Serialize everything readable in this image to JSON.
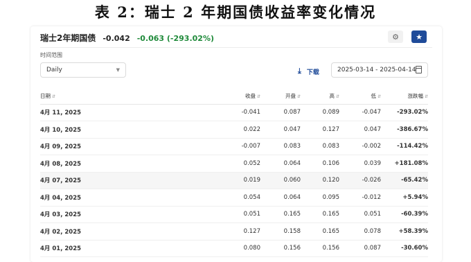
{
  "caption": "表 2：瑞士 2 年期国债收益率变化情况",
  "header": {
    "title": "瑞士2年期国债",
    "last": "-0.042",
    "change": "-0.063 (-293.02%)"
  },
  "icons": {
    "alert": "bell-icon",
    "watch": "star-icon"
  },
  "filters": {
    "range_label": "时间范围",
    "interval": "Daily",
    "download_label": "下载",
    "date_range": "2025-03-14 - 2025-04-14"
  },
  "colors": {
    "up": "#d23a3a",
    "down": "#1f8a3a",
    "accent": "#1f4b99"
  },
  "table": {
    "columns": [
      "日期",
      "收盘",
      "开盘",
      "高",
      "低",
      "涨跌幅"
    ],
    "rows": [
      {
        "date": "4月 11, 2025",
        "close": "-0.041",
        "open": "0.087",
        "high": "0.089",
        "low": "-0.047",
        "pct": "-293.02%",
        "dir": "neg"
      },
      {
        "date": "4月 10, 2025",
        "close": "0.022",
        "open": "0.047",
        "high": "0.127",
        "low": "0.047",
        "pct": "-386.67%",
        "dir": "neg"
      },
      {
        "date": "4月 09, 2025",
        "close": "-0.007",
        "open": "0.083",
        "high": "0.083",
        "low": "-0.002",
        "pct": "-114.42%",
        "dir": "neg"
      },
      {
        "date": "4月 08, 2025",
        "close": "0.052",
        "open": "0.064",
        "high": "0.106",
        "low": "0.039",
        "pct": "+181.08%",
        "dir": "pos"
      },
      {
        "date": "4月 07, 2025",
        "close": "0.019",
        "open": "0.060",
        "high": "0.120",
        "low": "-0.026",
        "pct": "-65.42%",
        "dir": "neg"
      },
      {
        "date": "4月 04, 2025",
        "close": "0.054",
        "open": "0.064",
        "high": "0.095",
        "low": "-0.012",
        "pct": "+5.94%",
        "dir": "pos"
      },
      {
        "date": "4月 03, 2025",
        "close": "0.051",
        "open": "0.165",
        "high": "0.165",
        "low": "0.051",
        "pct": "-60.39%",
        "dir": "neg"
      },
      {
        "date": "4月 02, 2025",
        "close": "0.127",
        "open": "0.158",
        "high": "0.165",
        "low": "0.078",
        "pct": "+58.39%",
        "dir": "pos"
      },
      {
        "date": "4月 01, 2025",
        "close": "0.080",
        "open": "0.156",
        "high": "0.156",
        "low": "0.087",
        "pct": "-30.60%",
        "dir": "neg"
      }
    ]
  }
}
